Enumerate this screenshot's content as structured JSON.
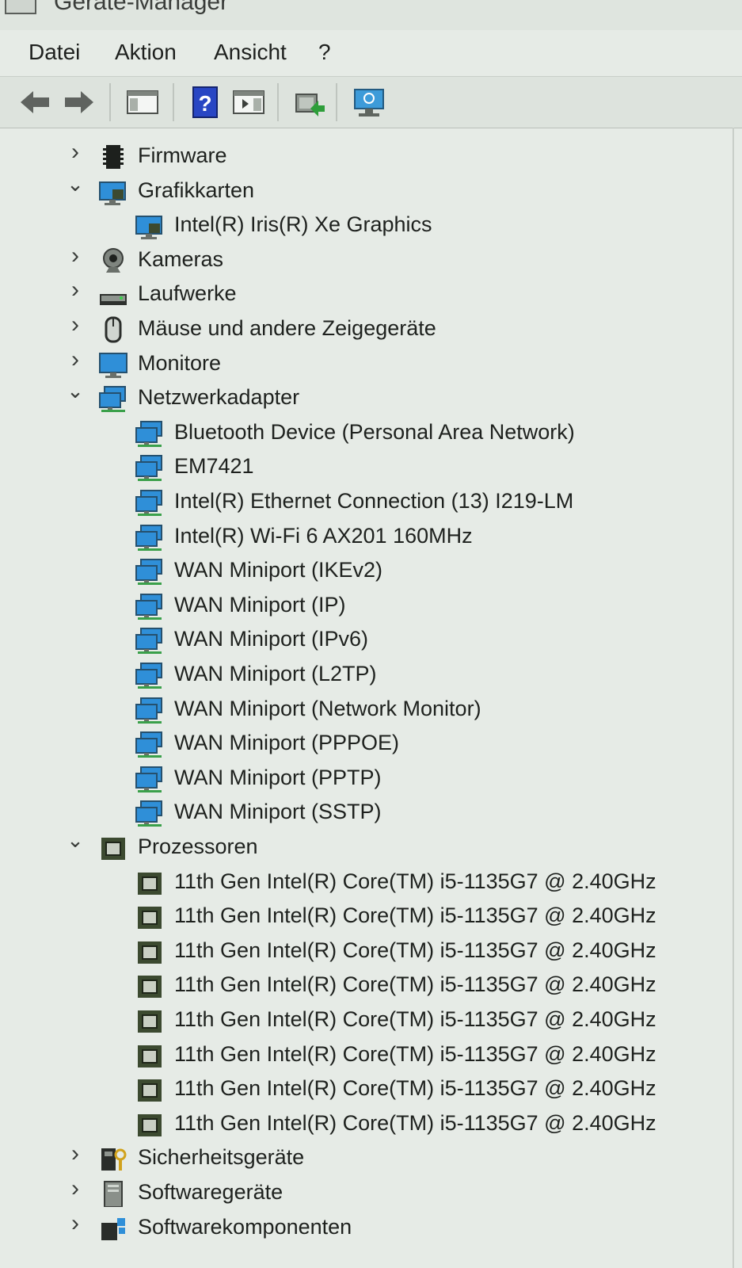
{
  "window": {
    "title": "Geräte-Manager"
  },
  "menu": [
    "Datei",
    "Aktion",
    "Ansicht",
    "?"
  ],
  "toolbar": [
    {
      "name": "back-arrow-icon"
    },
    {
      "name": "forward-arrow-icon"
    },
    {
      "name": "show-hide-console-tree-icon"
    },
    {
      "name": "help-icon",
      "glyph": "?"
    },
    {
      "name": "action-pane-icon"
    },
    {
      "name": "update-driver-icon"
    },
    {
      "name": "scan-hardware-changes-icon"
    }
  ],
  "tree": [
    {
      "type": "category",
      "label": "Firmware",
      "expanded": false,
      "icon": "firmware-icon"
    },
    {
      "type": "category",
      "label": "Grafikkarten",
      "expanded": true,
      "icon": "display-adapter-icon"
    },
    {
      "type": "device",
      "label": "Intel(R) Iris(R) Xe Graphics",
      "icon": "display-adapter-icon"
    },
    {
      "type": "category",
      "label": "Kameras",
      "expanded": false,
      "icon": "camera-icon"
    },
    {
      "type": "category",
      "label": "Laufwerke",
      "expanded": false,
      "icon": "disk-drive-icon"
    },
    {
      "type": "category",
      "label": "Mäuse und andere Zeigegeräte",
      "expanded": false,
      "icon": "mouse-icon"
    },
    {
      "type": "category",
      "label": "Monitore",
      "expanded": false,
      "icon": "monitor-icon"
    },
    {
      "type": "category",
      "label": "Netzwerkadapter",
      "expanded": true,
      "icon": "network-adapter-icon"
    },
    {
      "type": "device",
      "label": "Bluetooth Device (Personal Area Network)",
      "icon": "network-adapter-icon"
    },
    {
      "type": "device",
      "label": "EM7421",
      "icon": "network-adapter-icon"
    },
    {
      "type": "device",
      "label": "Intel(R) Ethernet Connection (13) I219-LM",
      "icon": "network-adapter-icon"
    },
    {
      "type": "device",
      "label": "Intel(R) Wi-Fi 6 AX201 160MHz",
      "icon": "network-adapter-icon"
    },
    {
      "type": "device",
      "label": "WAN Miniport (IKEv2)",
      "icon": "network-adapter-icon"
    },
    {
      "type": "device",
      "label": "WAN Miniport (IP)",
      "icon": "network-adapter-icon"
    },
    {
      "type": "device",
      "label": "WAN Miniport (IPv6)",
      "icon": "network-adapter-icon"
    },
    {
      "type": "device",
      "label": "WAN Miniport (L2TP)",
      "icon": "network-adapter-icon"
    },
    {
      "type": "device",
      "label": "WAN Miniport (Network Monitor)",
      "icon": "network-adapter-icon"
    },
    {
      "type": "device",
      "label": "WAN Miniport (PPPOE)",
      "icon": "network-adapter-icon"
    },
    {
      "type": "device",
      "label": "WAN Miniport (PPTP)",
      "icon": "network-adapter-icon"
    },
    {
      "type": "device",
      "label": "WAN Miniport (SSTP)",
      "icon": "network-adapter-icon"
    },
    {
      "type": "category",
      "label": "Prozessoren",
      "expanded": true,
      "icon": "processor-icon"
    },
    {
      "type": "device",
      "label": "11th Gen Intel(R) Core(TM) i5-1135G7 @ 2.40GHz",
      "icon": "processor-icon"
    },
    {
      "type": "device",
      "label": "11th Gen Intel(R) Core(TM) i5-1135G7 @ 2.40GHz",
      "icon": "processor-icon"
    },
    {
      "type": "device",
      "label": "11th Gen Intel(R) Core(TM) i5-1135G7 @ 2.40GHz",
      "icon": "processor-icon"
    },
    {
      "type": "device",
      "label": "11th Gen Intel(R) Core(TM) i5-1135G7 @ 2.40GHz",
      "icon": "processor-icon"
    },
    {
      "type": "device",
      "label": "11th Gen Intel(R) Core(TM) i5-1135G7 @ 2.40GHz",
      "icon": "processor-icon"
    },
    {
      "type": "device",
      "label": "11th Gen Intel(R) Core(TM) i5-1135G7 @ 2.40GHz",
      "icon": "processor-icon"
    },
    {
      "type": "device",
      "label": "11th Gen Intel(R) Core(TM) i5-1135G7 @ 2.40GHz",
      "icon": "processor-icon"
    },
    {
      "type": "device",
      "label": "11th Gen Intel(R) Core(TM) i5-1135G7 @ 2.40GHz",
      "icon": "processor-icon"
    },
    {
      "type": "category",
      "label": "Sicherheitsgeräte",
      "expanded": false,
      "icon": "security-device-icon"
    },
    {
      "type": "category",
      "label": "Softwaregeräte",
      "expanded": false,
      "icon": "software-device-icon"
    },
    {
      "type": "category",
      "label": "Softwarekomponenten",
      "expanded": false,
      "icon": "software-component-icon"
    }
  ],
  "colors": {
    "background": "#e6ebe6",
    "toolbar": "#dde3dd",
    "monitor_blue": "#2f8fd8",
    "chip_green": "#3c4a30"
  }
}
